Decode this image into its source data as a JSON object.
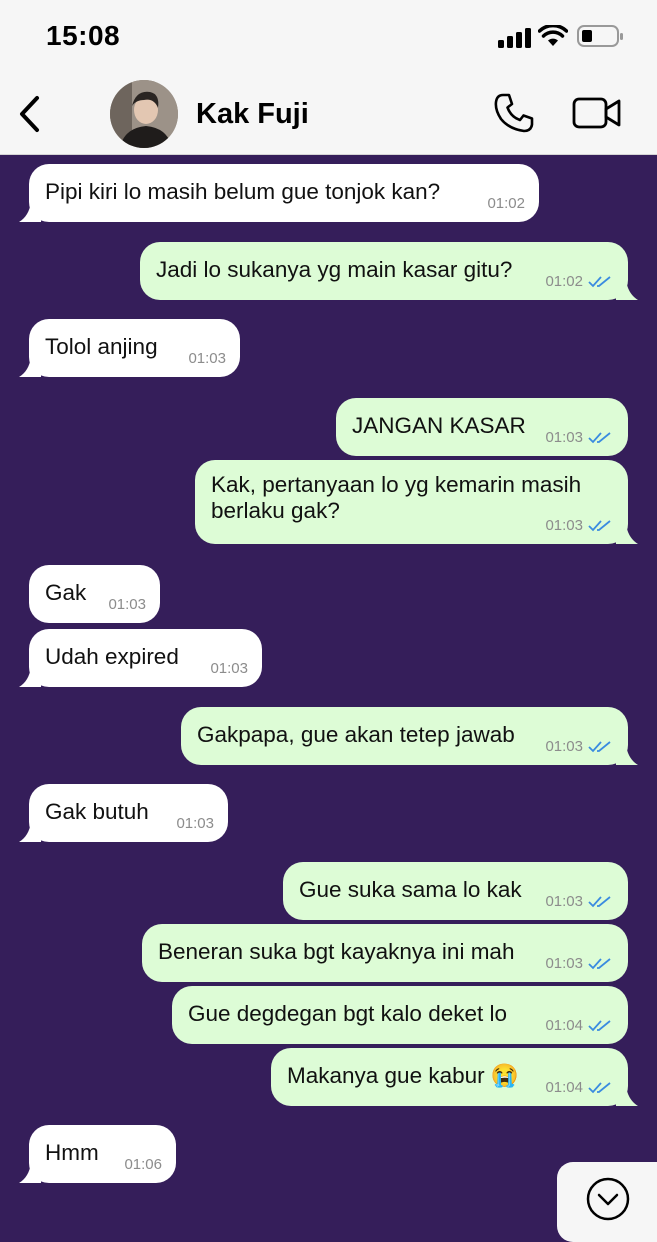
{
  "status_bar": {
    "time": "15:08"
  },
  "header": {
    "contact_name": "Kak Fuji"
  },
  "messages": [
    {
      "text": "Pipi kiri lo masih belum gue tonjok kan?",
      "time": "01:02",
      "dir": "in"
    },
    {
      "text": "Jadi lo sukanya yg main kasar gitu?",
      "time": "01:02",
      "dir": "out"
    },
    {
      "text": "Tolol anjing",
      "time": "01:03",
      "dir": "in"
    },
    {
      "text": "JANGAN KASAR",
      "time": "01:03",
      "dir": "out"
    },
    {
      "text": "Kak, pertanyaan lo yg kemarin masih berlaku gak?",
      "time": "01:03",
      "dir": "out"
    },
    {
      "text": "Gak",
      "time": "01:03",
      "dir": "in"
    },
    {
      "text": "Udah expired",
      "time": "01:03",
      "dir": "in"
    },
    {
      "text": "Gakpapa, gue akan tetep jawab",
      "time": "01:03",
      "dir": "out"
    },
    {
      "text": "Gak butuh",
      "time": "01:03",
      "dir": "in"
    },
    {
      "text": "Gue suka sama lo kak",
      "time": "01:03",
      "dir": "out"
    },
    {
      "text": "Beneran suka bgt kayaknya ini mah",
      "time": "01:03",
      "dir": "out"
    },
    {
      "text": "Gue degdegan bgt kalo deket lo",
      "time": "01:04",
      "dir": "out"
    },
    {
      "text": "Makanya gue kabur 😭",
      "time": "01:04",
      "dir": "out"
    },
    {
      "text": "Hmm",
      "time": "01:06",
      "dir": "in"
    }
  ],
  "colors": {
    "chat_background": "#351E5A",
    "incoming_bubble": "#FFFFFF",
    "outgoing_bubble": "#DDFCD6",
    "read_ticks": "#3A8BE0"
  }
}
